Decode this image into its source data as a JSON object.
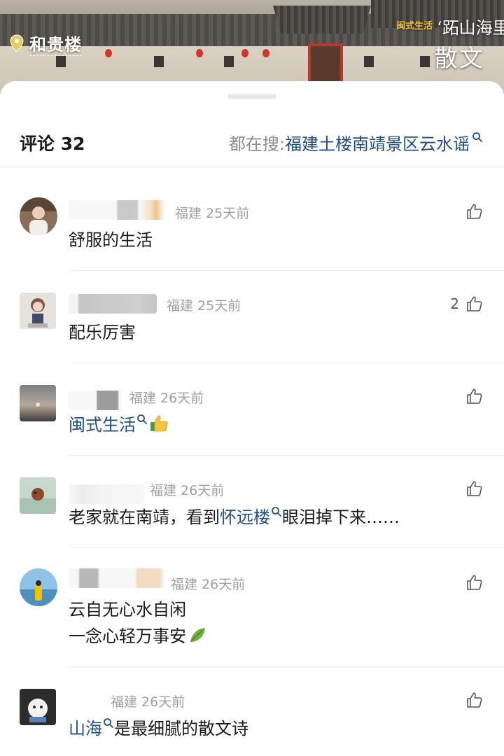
{
  "video": {
    "location_tag": "和贵楼",
    "brand": "闽式生活",
    "title_line1": "‘跖山海里",
    "title_line2": "散文诗"
  },
  "sheet": {
    "comment_label": "评论 32",
    "search_prefix": "都在搜: ",
    "search_term": "福建土楼南靖景区云水谣"
  },
  "comments": [
    {
      "meta": "福建 25天前",
      "text": "舒服的生活",
      "likes": ""
    },
    {
      "meta": "福建 25天前",
      "text": "配乐厉害",
      "likes": "2"
    },
    {
      "meta": "福建 26天前",
      "link": "闽式生活",
      "emoji": "thumbs-up-emoji"
    },
    {
      "meta": "福建 26天前",
      "text_before": "老家就在南靖，看到",
      "link": "怀远楼",
      "text_after": "眼泪掉下来……"
    },
    {
      "meta": "福建 26天前",
      "line1": "云自无心水自闲",
      "line2": "一念心轻万事安",
      "emoji": "leaf-emoji"
    },
    {
      "meta": "福建 26天前",
      "link": "山海",
      "text_after": "是最细腻的散文诗"
    }
  ],
  "icons": {
    "like": "thumbs-up-outline-icon",
    "search": "magnifier-icon",
    "location": "pin-icon"
  },
  "colors": {
    "link": "#1f4e86",
    "meta": "#a0a0a0",
    "text": "#1a1a1a"
  }
}
